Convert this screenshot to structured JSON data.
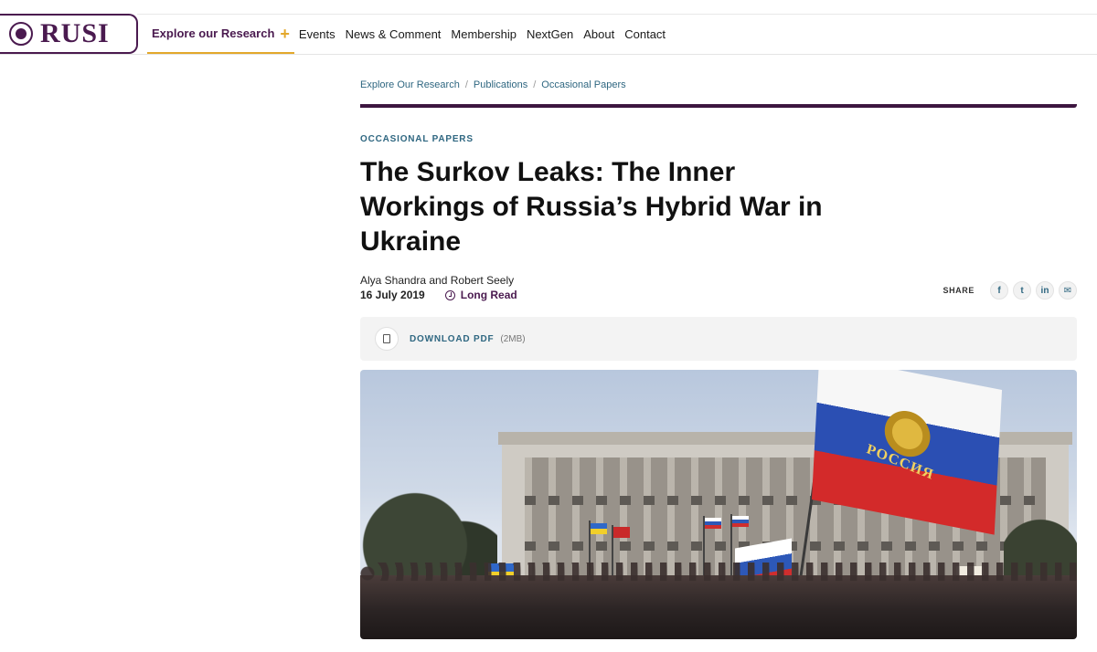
{
  "header": {
    "logo_text": "RUSI",
    "nav": [
      {
        "label": "Explore our Research",
        "active": true
      },
      {
        "label": "Events"
      },
      {
        "label": "News & Comment"
      },
      {
        "label": "Membership"
      },
      {
        "label": "NextGen"
      },
      {
        "label": "About"
      },
      {
        "label": "Contact"
      }
    ]
  },
  "breadcrumb": [
    "Explore Our Research",
    "Publications",
    "Occasional Papers"
  ],
  "article": {
    "kicker": "OCCASIONAL PAPERS",
    "title": "The Surkov Leaks: The Inner Workings of Russia’s Hybrid War in Ukraine",
    "authors": "Alya Shandra and Robert Seely",
    "date": "16 July 2019",
    "read_type": "Long Read"
  },
  "share": {
    "label": "SHARE",
    "buttons": [
      {
        "icon": "facebook-icon",
        "glyph": "f"
      },
      {
        "icon": "twitter-icon",
        "glyph": "t"
      },
      {
        "icon": "linkedin-icon",
        "glyph": "in"
      },
      {
        "icon": "email-icon",
        "glyph": "✉"
      }
    ]
  },
  "download": {
    "label": "DOWNLOAD PDF",
    "size": "(2MB)"
  },
  "hero": {
    "flag_text": "РОССИЯ"
  },
  "colors": {
    "brand": "#4a1a4f",
    "accent": "#e3a82b",
    "link": "#2f6781"
  }
}
